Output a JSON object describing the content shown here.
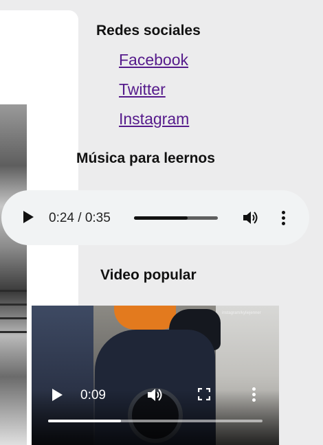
{
  "social": {
    "heading": "Redes sociales",
    "links": [
      {
        "label": "Facebook"
      },
      {
        "label": "Twitter"
      },
      {
        "label": "Instagram"
      }
    ],
    "link_color": "#551a8b"
  },
  "music": {
    "heading": "Música para leernos",
    "player": {
      "current_time": "0:24",
      "duration": "0:35",
      "time_display": "0:24 / 0:35",
      "progress": 0.64
    }
  },
  "video": {
    "heading": "Video popular",
    "player": {
      "current_time": "0:09",
      "progress": 0.34,
      "watermark": "instagram/kyliejenner"
    }
  },
  "colors": {
    "page_background": "#ececed",
    "card_background": "#ffffff",
    "audio_background": "#f1f3f4"
  },
  "icons": {
    "audio": [
      "play-icon",
      "volume-icon",
      "more-options-icon"
    ],
    "video": [
      "play-icon",
      "volume-icon",
      "fullscreen-icon",
      "more-options-icon"
    ]
  }
}
